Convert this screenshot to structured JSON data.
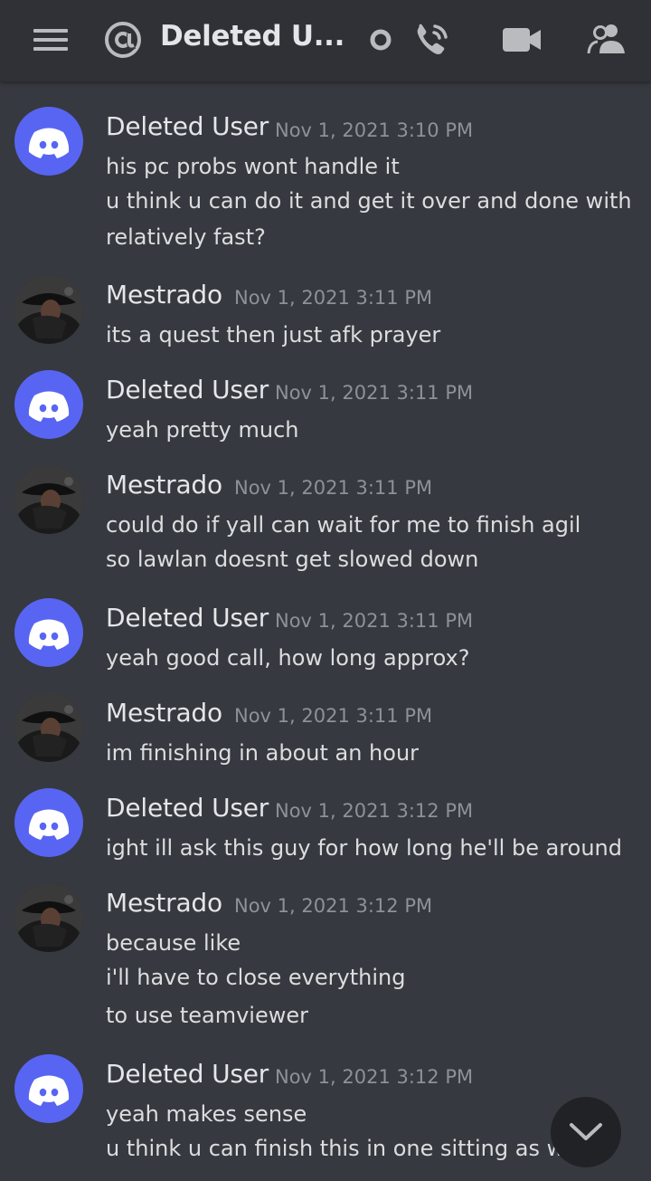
{
  "header": {
    "title": "Deleted U...",
    "icons": {
      "menu": "menu-icon",
      "mention": "at-icon",
      "status": "status-ring-icon",
      "call": "phone-call-icon",
      "video": "video-camera-icon",
      "members": "members-icon"
    }
  },
  "colors": {
    "background": "#36393f",
    "header_background": "#2f3136",
    "discord_blurple": "#5865f2",
    "username": "#e4e6e9",
    "timestamp": "#8e9297",
    "message_text": "#dcddde"
  },
  "messages": [
    {
      "author": "Deleted User",
      "timestamp": "Nov 1, 2021 3:10 PM",
      "avatar": "discord-default-avatar",
      "lines": [
        "his pc probs wont handle it",
        "u think u can do it and get it over and done with",
        "relatively fast?"
      ]
    },
    {
      "author": "Mestrado",
      "timestamp": "Nov 1, 2021 3:11 PM",
      "avatar": "user-photo-avatar",
      "lines": [
        "its a quest then just afk prayer"
      ]
    },
    {
      "author": "Deleted User",
      "timestamp": "Nov 1, 2021 3:11 PM",
      "avatar": "discord-default-avatar",
      "lines": [
        "yeah pretty much"
      ]
    },
    {
      "author": "Mestrado",
      "timestamp": "Nov 1, 2021 3:11 PM",
      "avatar": "user-photo-avatar",
      "lines": [
        "could do if yall can wait for me to finish agil",
        "so lawlan doesnt get slowed down"
      ]
    },
    {
      "author": "Deleted User",
      "timestamp": "Nov 1, 2021 3:11 PM",
      "avatar": "discord-default-avatar",
      "lines": [
        "yeah good call, how long approx?"
      ]
    },
    {
      "author": "Mestrado",
      "timestamp": "Nov 1, 2021 3:11 PM",
      "avatar": "user-photo-avatar",
      "lines": [
        "im finishing in about an hour"
      ]
    },
    {
      "author": "Deleted User",
      "timestamp": "Nov 1, 2021 3:12 PM",
      "avatar": "discord-default-avatar",
      "lines": [
        "ight ill ask this guy for how long he'll be around"
      ]
    },
    {
      "author": "Mestrado",
      "timestamp": "Nov 1, 2021 3:12 PM",
      "avatar": "user-photo-avatar",
      "lines": [
        "because like",
        "i'll have to close everything",
        "to use teamviewer"
      ]
    },
    {
      "author": "Deleted User",
      "timestamp": "Nov 1, 2021 3:12 PM",
      "avatar": "discord-default-avatar",
      "lines": [
        "yeah makes sense",
        "u think u can finish this in one sitting as we"
      ]
    }
  ],
  "scroll_button": {
    "icon": "chevron-down-icon"
  }
}
